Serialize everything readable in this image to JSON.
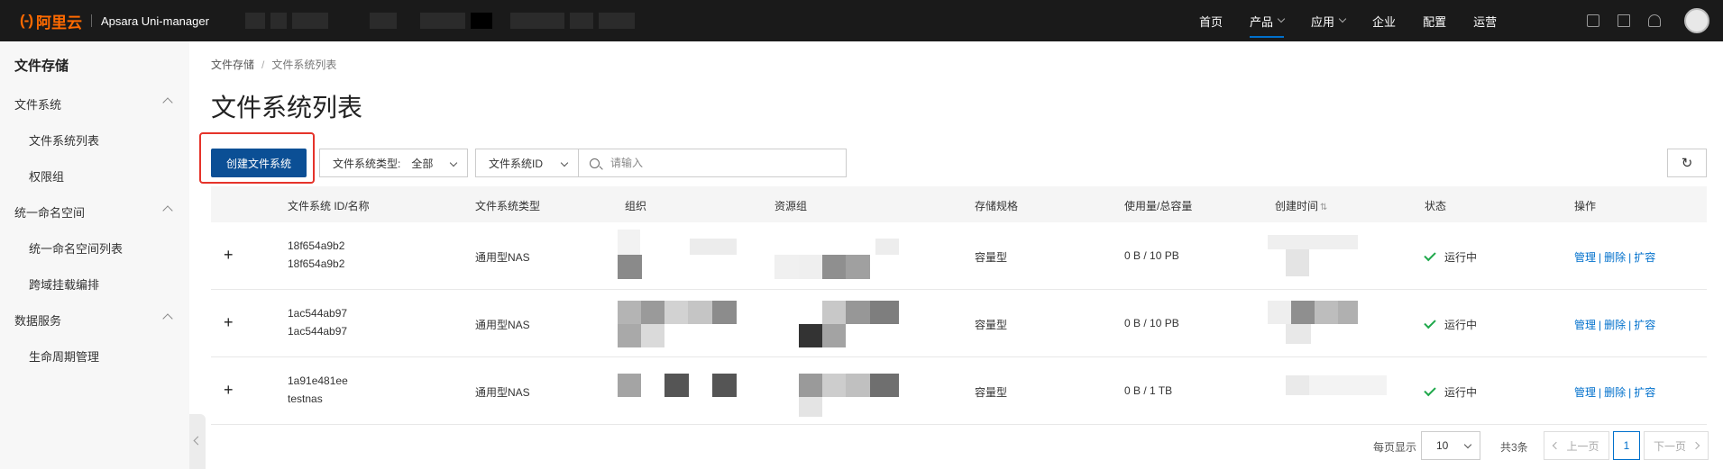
{
  "topbar": {
    "logo_mark": "(-)",
    "logo_text": "阿里云",
    "product_name": "Apsara Uni-manager",
    "nav": [
      {
        "label": "首页",
        "dropdown": false,
        "active": false
      },
      {
        "label": "产品",
        "dropdown": true,
        "active": true
      },
      {
        "label": "应用",
        "dropdown": true,
        "active": false
      },
      {
        "label": "企业",
        "dropdown": false,
        "active": false
      },
      {
        "label": "配置",
        "dropdown": false,
        "active": false
      },
      {
        "label": "运营",
        "dropdown": false,
        "active": false
      }
    ],
    "icons": [
      "screen-icon",
      "book-icon",
      "bell-icon"
    ],
    "accent_color": "#0070cc",
    "logo_color": "#ff6a00"
  },
  "sidebar": {
    "title": "文件存储",
    "groups": [
      {
        "label": "文件系统",
        "items": [
          "文件系统列表",
          "权限组"
        ]
      },
      {
        "label": "统一命名空间",
        "items": [
          "统一命名空间列表",
          "跨域挂载编排"
        ]
      },
      {
        "label": "数据服务",
        "items": [
          "生命周期管理"
        ]
      }
    ]
  },
  "breadcrumb": {
    "root": "文件存储",
    "separator": "/",
    "current": "文件系统列表"
  },
  "page_title": "文件系统列表",
  "toolbar": {
    "create_label": "创建文件系统",
    "type_filter_label": "文件系统类型:",
    "type_filter_value": "全部",
    "id_filter_value": "文件系统ID",
    "search_placeholder": "请输入",
    "refresh_icon": "refresh-icon",
    "highlight_color": "#e5332a"
  },
  "table": {
    "columns": [
      "文件系统 ID/名称",
      "文件系统类型",
      "组织",
      "资源组",
      "存储规格",
      "使用量/总容量",
      "创建时间",
      "状态",
      "操作"
    ],
    "rows": [
      {
        "id": "18f654a9b2",
        "name": "18f654a9b2",
        "type": "通用型NAS",
        "spec": "容量型",
        "usage": "0 B / 10 PB",
        "status": "运行中",
        "ops": [
          "管理",
          "删除",
          "扩容"
        ]
      },
      {
        "id": "1ac544ab97",
        "name": "1ac544ab97",
        "type": "通用型NAS",
        "spec": "容量型",
        "usage": "0 B / 10 PB",
        "status": "运行中",
        "ops": [
          "管理",
          "删除",
          "扩容"
        ]
      },
      {
        "id": "1a91e481ee",
        "name": "testnas",
        "type": "通用型NAS",
        "spec": "容量型",
        "usage": "0 B / 1 TB",
        "status": "运行中",
        "ops": [
          "管理",
          "删除",
          "扩容"
        ]
      }
    ]
  },
  "pagination": {
    "per_page_label": "每页显示",
    "per_page_value": "10",
    "total": "共3条",
    "prev": "上一页",
    "current": "1",
    "next": "下一页"
  }
}
